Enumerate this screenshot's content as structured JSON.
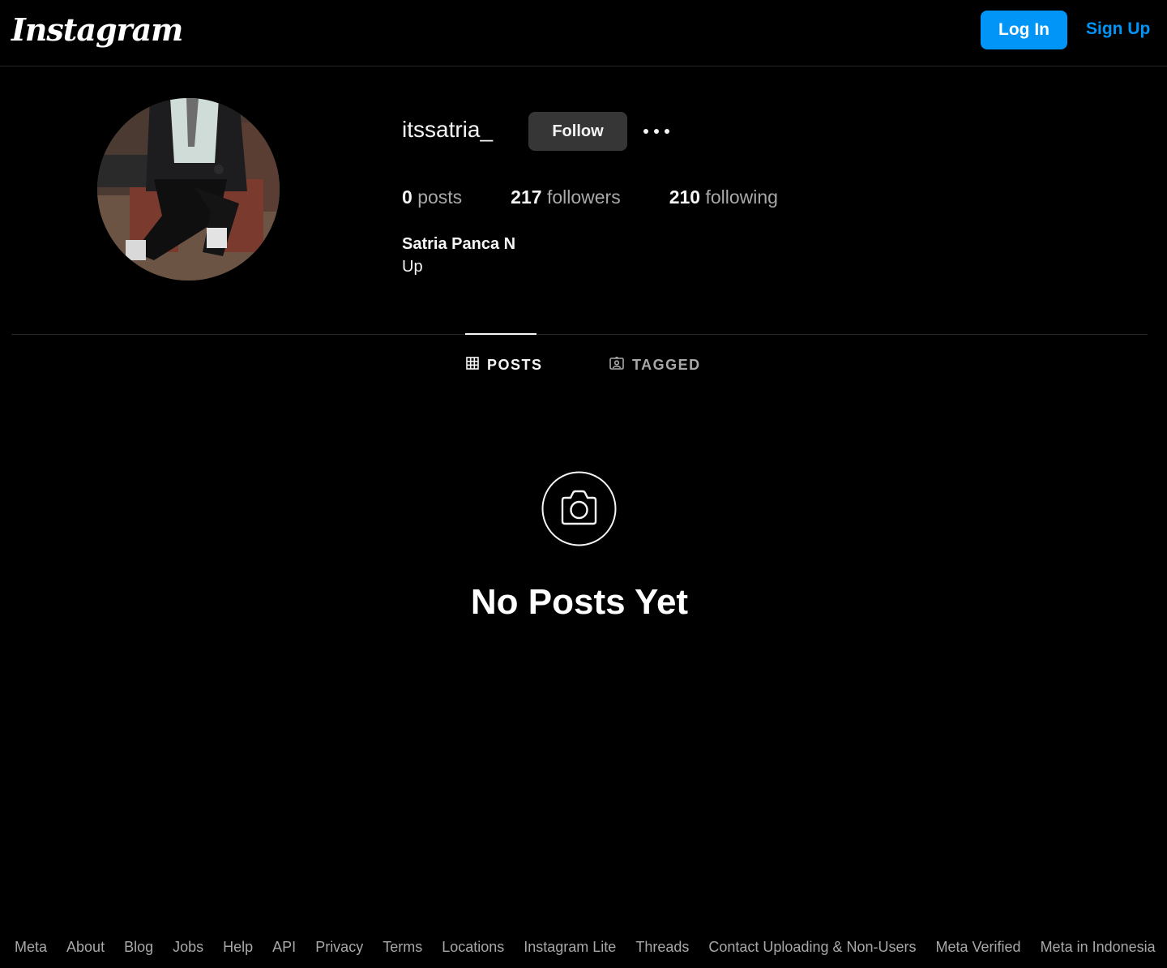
{
  "header": {
    "logo": "Instagram",
    "login_label": "Log In",
    "signup_label": "Sign Up"
  },
  "profile": {
    "username": "itssatria_",
    "follow_label": "Follow",
    "posts_count": "0",
    "posts_label": "posts",
    "followers_count": "217",
    "followers_label": "followers",
    "following_count": "210",
    "following_label": "following",
    "full_name": "Satria Panca N",
    "bio": "Up"
  },
  "tabs": [
    {
      "label": "POSTS",
      "icon": "grid-icon",
      "active": true
    },
    {
      "label": "TAGGED",
      "icon": "tagged-icon",
      "active": false
    }
  ],
  "empty_state": {
    "icon": "camera-icon",
    "title": "No Posts Yet"
  },
  "footer": {
    "links": [
      "Meta",
      "About",
      "Blog",
      "Jobs",
      "Help",
      "API",
      "Privacy",
      "Terms",
      "Locations",
      "Instagram Lite",
      "Threads",
      "Contact Uploading & Non-Users",
      "Meta Verified",
      "Meta in Indonesia"
    ]
  },
  "colors": {
    "background": "#000000",
    "primary": "#0095f6",
    "follow_button": "#363636",
    "muted_text": "#a8a8a8"
  }
}
